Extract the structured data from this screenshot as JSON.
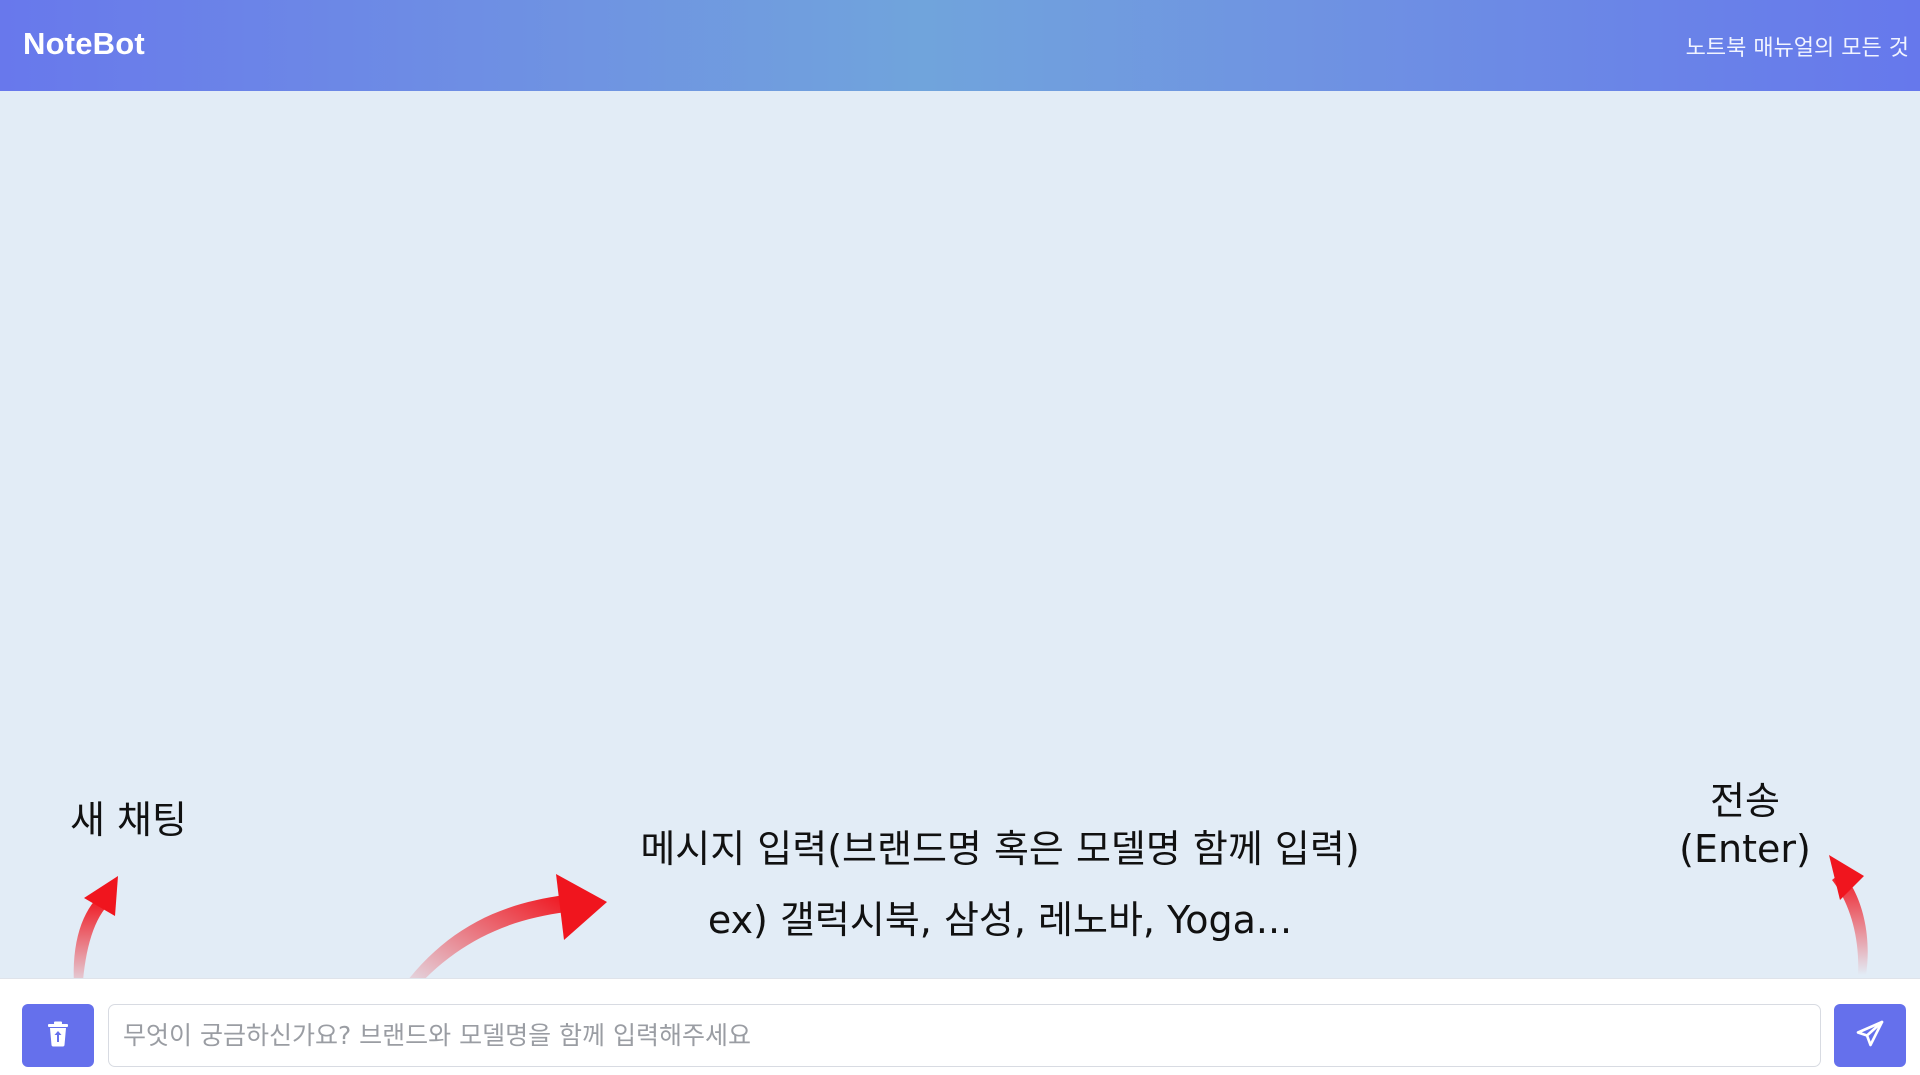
{
  "header": {
    "brand": "NoteBot",
    "tagline": "노트북 매뉴얼의 모든 것"
  },
  "annotations": {
    "new_chat": "새 채팅",
    "message_line1": "메시지 입력(브랜드명 혹은 모델명 함께 입력)",
    "message_line2": "ex) 갤럭시북, 삼성, 레노바, Yoga...",
    "send_line1": "전송",
    "send_line2": "(Enter)"
  },
  "input": {
    "value": "",
    "placeholder": "무엇이 궁금하신가요? 브랜드와 모델명을 함께 입력해주세요"
  },
  "icons": {
    "new_chat": "trash-icon",
    "send": "paper-plane-icon"
  },
  "colors": {
    "accent": "#6570ec",
    "background": "#e2ecf6",
    "annotation_arrow": "#f0151e"
  }
}
